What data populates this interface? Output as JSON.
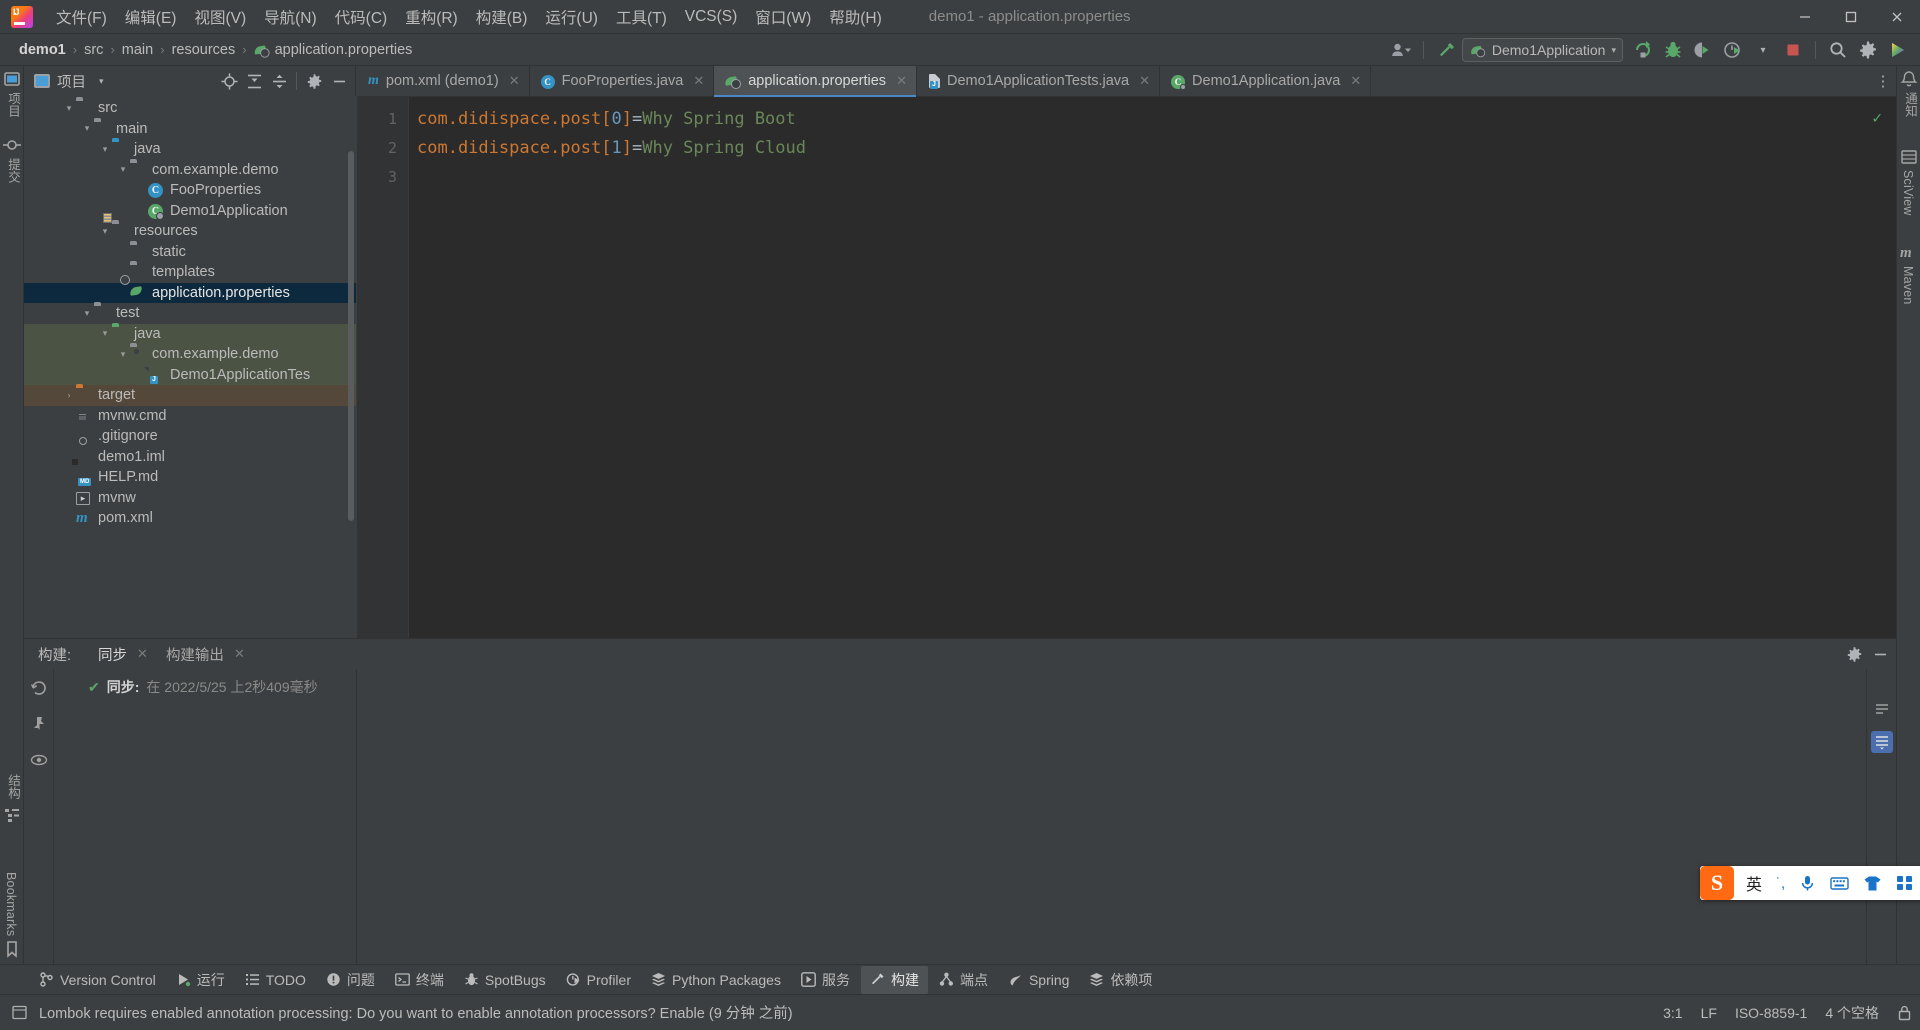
{
  "window": {
    "title": "demo1 - application.properties",
    "controls": {
      "minimize": "—",
      "maximize": "❐",
      "close": "✕"
    }
  },
  "menu": {
    "items": [
      {
        "label": "文件(F)"
      },
      {
        "label": "编辑(E)"
      },
      {
        "label": "视图(V)"
      },
      {
        "label": "导航(N)"
      },
      {
        "label": "代码(C)"
      },
      {
        "label": "重构(R)"
      },
      {
        "label": "构建(B)"
      },
      {
        "label": "运行(U)"
      },
      {
        "label": "工具(T)"
      },
      {
        "label": "VCS(S)"
      },
      {
        "label": "窗口(W)"
      },
      {
        "label": "帮助(H)"
      }
    ]
  },
  "navbar": {
    "breadcrumbs": [
      {
        "label": "demo1",
        "bold": true
      },
      {
        "label": "src",
        "bold": false
      },
      {
        "label": "main",
        "bold": false
      },
      {
        "label": "resources",
        "bold": false
      },
      {
        "label": "application.properties",
        "bold": false,
        "icon": "spring-properties-icon"
      }
    ],
    "separator": "›",
    "run_config": "Demo1Application",
    "actions": [
      "user-avatar-icon",
      "build-hammer-icon",
      "run-icon",
      "debug-icon",
      "run-coverage-icon",
      "profiler-icon",
      "stop-icon",
      "search-icon",
      "settings-gear-icon",
      "ai-assistant-icon"
    ]
  },
  "project": {
    "title": "项目",
    "header_actions": [
      "locate-target-icon",
      "expand-all-icon",
      "collapse-all-icon",
      "settings-gear-icon",
      "hide-icon"
    ],
    "tree": [
      {
        "label": "src",
        "indent": 1,
        "arrow": "expanded",
        "icon": "folder-gray",
        "state": ""
      },
      {
        "label": "main",
        "indent": 2,
        "arrow": "expanded",
        "icon": "folder-gray",
        "state": ""
      },
      {
        "label": "java",
        "indent": 3,
        "arrow": "expanded",
        "icon": "folder-blue",
        "state": ""
      },
      {
        "label": "com.example.demo",
        "indent": 4,
        "arrow": "expanded",
        "icon": "folder-package",
        "state": ""
      },
      {
        "label": "FooProperties",
        "indent": 5,
        "arrow": "none",
        "icon": "class-icon",
        "state": ""
      },
      {
        "label": "Demo1Application",
        "indent": 5,
        "arrow": "none",
        "icon": "spring-class-run-icon",
        "state": ""
      },
      {
        "label": "resources",
        "indent": 3,
        "arrow": "expanded",
        "icon": "folder-resources",
        "state": ""
      },
      {
        "label": "static",
        "indent": 4,
        "arrow": "none",
        "icon": "folder-gray",
        "state": ""
      },
      {
        "label": "templates",
        "indent": 4,
        "arrow": "none",
        "icon": "folder-gray",
        "state": ""
      },
      {
        "label": "application.properties",
        "indent": 4,
        "arrow": "none",
        "icon": "spring-properties-icon",
        "state": "selected"
      },
      {
        "label": "test",
        "indent": 2,
        "arrow": "expanded",
        "icon": "folder-gray",
        "state": ""
      },
      {
        "label": "java",
        "indent": 3,
        "arrow": "expanded",
        "icon": "folder-green",
        "state": "test"
      },
      {
        "label": "com.example.demo",
        "indent": 4,
        "arrow": "expanded",
        "icon": "folder-package",
        "state": "test"
      },
      {
        "label": "Demo1ApplicationTes",
        "indent": 5,
        "arrow": "none",
        "icon": "java-test-icon",
        "state": "test"
      },
      {
        "label": "target",
        "indent": 1,
        "arrow": "collapsed",
        "icon": "folder-orange",
        "state": "target"
      },
      {
        "label": "mvnw.cmd",
        "indent": 1,
        "arrow": "none",
        "icon": "file-doc-icon",
        "state": ""
      },
      {
        "label": ".gitignore",
        "indent": 1,
        "arrow": "none",
        "icon": "gitignore-icon",
        "state": ""
      },
      {
        "label": "demo1.iml",
        "indent": 1,
        "arrow": "none",
        "icon": "iml-file-icon",
        "state": ""
      },
      {
        "label": "HELP.md",
        "indent": 1,
        "arrow": "none",
        "icon": "markdown-icon",
        "state": ""
      },
      {
        "label": "mvnw",
        "indent": 1,
        "arrow": "none",
        "icon": "shell-script-icon",
        "state": ""
      },
      {
        "label": "pom.xml",
        "indent": 1,
        "arrow": "none",
        "icon": "maven-icon",
        "state": ""
      }
    ]
  },
  "editor": {
    "tabs": [
      {
        "label": "pom.xml (demo1)",
        "icon": "maven-icon",
        "active": false
      },
      {
        "label": "FooProperties.java",
        "icon": "class-icon",
        "active": false
      },
      {
        "label": "application.properties",
        "icon": "spring-properties-icon",
        "active": true
      },
      {
        "label": "Demo1ApplicationTests.java",
        "icon": "java-test-icon",
        "active": false
      },
      {
        "label": "Demo1Application.java",
        "icon": "spring-class-run-icon",
        "active": false
      }
    ],
    "tab_close": "✕",
    "more_tabs": "⋮",
    "line_numbers": [
      "1",
      "2",
      "3"
    ],
    "lines": [
      {
        "key": "com.didispace.post",
        "index": "0",
        "value": "Why Spring Boot"
      },
      {
        "key": "com.didispace.post",
        "index": "1",
        "value": "Why Spring Cloud"
      }
    ],
    "inspection_ok": "✓"
  },
  "build_panel": {
    "label": "构建:",
    "tabs": [
      {
        "label": "同步",
        "active": true,
        "close": "✕"
      },
      {
        "label": "构建输出",
        "active": false,
        "close": "✕"
      }
    ],
    "side_actions": [
      "rerun-icon",
      "pin-icon",
      "eye-icon"
    ],
    "header_actions": [
      "settings-gear-icon",
      "hide-icon"
    ],
    "rows": [
      {
        "status": "✔",
        "title": "同步:",
        "detail": "在 2022/5/25 上2秒409毫秒"
      }
    ]
  },
  "left_stripe": {
    "top": [
      "项目",
      "提交"
    ],
    "bottom": [
      "结构",
      "Bookmarks"
    ]
  },
  "right_stripe": {
    "items": [
      "通知",
      "SciView",
      "Maven"
    ]
  },
  "bottom_bar": {
    "items": [
      {
        "label": "Version Control",
        "icon": "branch-icon",
        "active": false
      },
      {
        "label": "运行",
        "icon": "run-icon",
        "active": false
      },
      {
        "label": "TODO",
        "icon": "todo-icon",
        "active": false
      },
      {
        "label": "问题",
        "icon": "problems-icon",
        "active": false
      },
      {
        "label": "终端",
        "icon": "terminal-icon",
        "active": false
      },
      {
        "label": "SpotBugs",
        "icon": "bug-icon",
        "active": false
      },
      {
        "label": "Profiler",
        "icon": "profiler-icon",
        "active": false
      },
      {
        "label": "Python Packages",
        "icon": "packages-icon",
        "active": false
      },
      {
        "label": "服务",
        "icon": "services-icon",
        "active": false
      },
      {
        "label": "构建",
        "icon": "hammer-icon",
        "active": true
      },
      {
        "label": "端点",
        "icon": "endpoints-icon",
        "active": false
      },
      {
        "label": "Spring",
        "icon": "spring-leaf-icon",
        "active": false
      },
      {
        "label": "依赖项",
        "icon": "dependencies-icon",
        "active": false
      }
    ]
  },
  "status_bar": {
    "message": "Lombok requires enabled annotation processing: Do you want to enable annotation processors? Enable (9 分钟 之前)",
    "caret": "3:1",
    "line_sep": "LF",
    "encoding": "ISO-8859-1",
    "indent": "4 个空格",
    "lock": "lock-icon"
  },
  "ime": {
    "logo": "S",
    "items": [
      {
        "label": "英",
        "type": "mode"
      },
      {
        "label": "˙,",
        "type": "punct"
      },
      {
        "label": "mic-icon",
        "type": "icon"
      },
      {
        "label": "keyboard-icon",
        "type": "icon"
      },
      {
        "label": "skin-icon",
        "type": "icon"
      },
      {
        "label": "toolbox-icon",
        "type": "icon"
      }
    ]
  },
  "colors": {
    "bg": "#3c3f41",
    "editor_bg": "#2b2b2b",
    "accent": "#4a88c7",
    "selection": "#0d293e",
    "test_scope": "#4b5344",
    "excluded_scope": "#54483a",
    "key": "#cc7832",
    "value": "#6a8759",
    "number": "#6897bb",
    "green": "#59a869",
    "orange": "#cc7832"
  }
}
